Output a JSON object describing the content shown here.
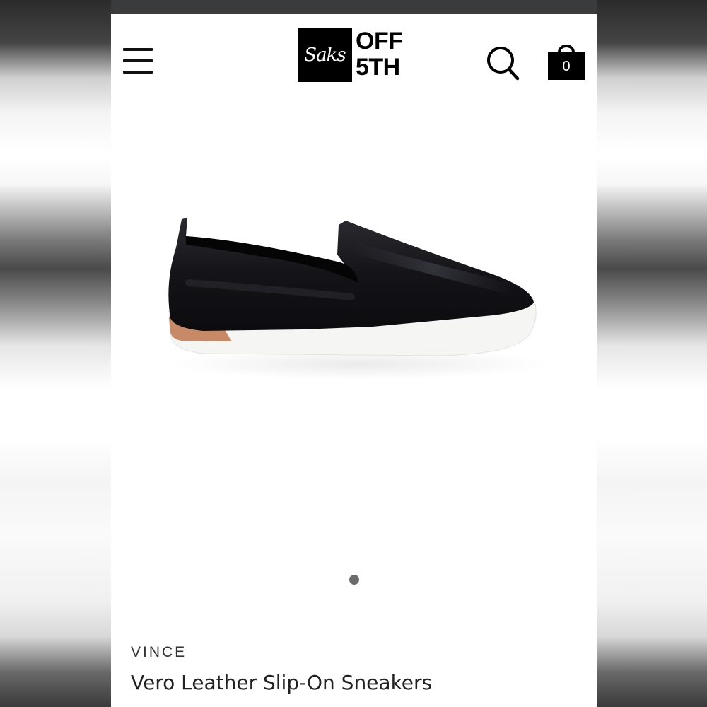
{
  "header": {
    "logo_script": "Saks",
    "logo_line1": "OFF",
    "logo_line2": "5TH",
    "cart_count": "0"
  },
  "icons": {
    "menu": "hamburger-menu-icon",
    "search": "search-icon",
    "cart": "shopping-bag-icon"
  },
  "carousel": {
    "current": 1,
    "total": 1
  },
  "product": {
    "brand": "VINCE",
    "name": "Vero Leather Slip-On Sneakers",
    "image_description_colors": {
      "upper": "#141418",
      "sole": "#f5f5f3",
      "heel_accent": "#c88a66"
    }
  },
  "colors": {
    "status_bar": "#3a3b3d",
    "text_primary": "#222222",
    "dot": "#6b6b6b"
  }
}
